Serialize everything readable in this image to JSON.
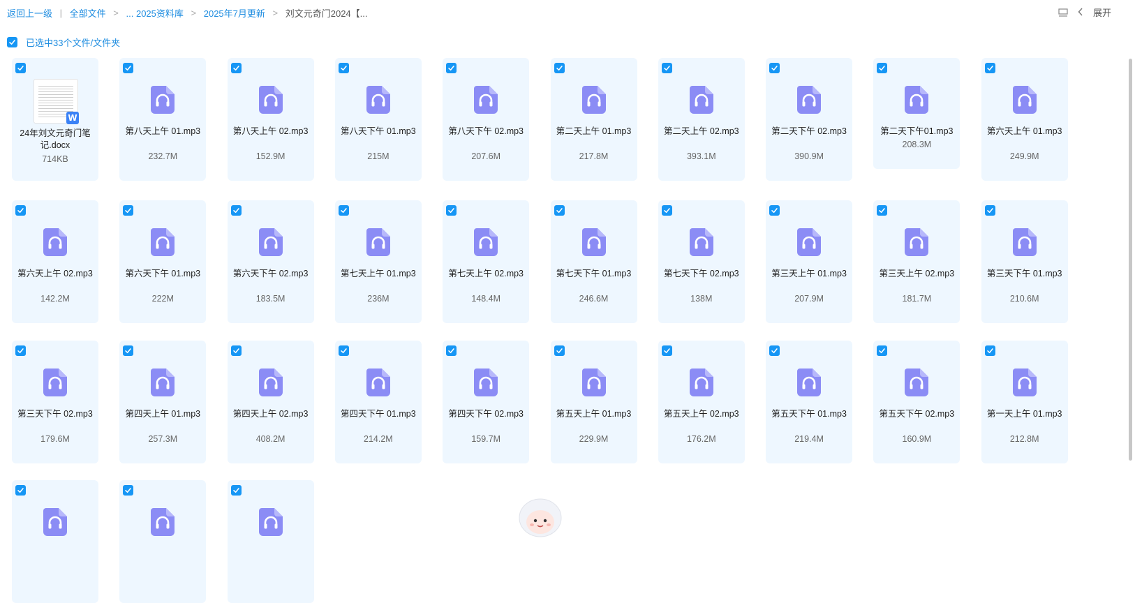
{
  "breadcrumb": {
    "back": "返回上一级",
    "all_files": "全部文件",
    "ellipsis_lib": "... 2025资料库",
    "july": "2025年7月更新",
    "current": "刘文元奇门2024【..."
  },
  "toolbar": {
    "expand_label": "展开"
  },
  "selection": {
    "label": "已选中33个文件/文件夹"
  },
  "colors": {
    "accent": "#1696f5",
    "tile_bg": "#eef7ff",
    "audio_icon": "#8b8cf5"
  },
  "files": [
    {
      "name": "24年刘文元奇门笔记.docx",
      "size": "714KB",
      "type": "doc",
      "checked": true
    },
    {
      "name": "第八天上午 01.mp3",
      "size": "232.7M",
      "type": "audio",
      "checked": true
    },
    {
      "name": "第八天上午 02.mp3",
      "size": "152.9M",
      "type": "audio",
      "checked": true
    },
    {
      "name": "第八天下午 01.mp3",
      "size": "215M",
      "type": "audio",
      "checked": true
    },
    {
      "name": "第八天下午 02.mp3",
      "size": "207.6M",
      "type": "audio",
      "checked": true
    },
    {
      "name": "第二天上午 01.mp3",
      "size": "217.8M",
      "type": "audio",
      "checked": true
    },
    {
      "name": "第二天上午 02.mp3",
      "size": "393.1M",
      "type": "audio",
      "checked": true
    },
    {
      "name": "第二天下午 02.mp3",
      "size": "390.9M",
      "type": "audio",
      "checked": true
    },
    {
      "name": "第二天下午01.mp3",
      "size": "208.3M",
      "type": "audio",
      "checked": true
    },
    {
      "name": "第六天上午 01.mp3",
      "size": "249.9M",
      "type": "audio",
      "checked": true
    },
    {
      "name": "第六天上午 02.mp3",
      "size": "142.2M",
      "type": "audio",
      "checked": true
    },
    {
      "name": "第六天下午 01.mp3",
      "size": "222M",
      "type": "audio",
      "checked": true
    },
    {
      "name": "第六天下午 02.mp3",
      "size": "183.5M",
      "type": "audio",
      "checked": true
    },
    {
      "name": "第七天上午 01.mp3",
      "size": "236M",
      "type": "audio",
      "checked": true
    },
    {
      "name": "第七天上午 02.mp3",
      "size": "148.4M",
      "type": "audio",
      "checked": true
    },
    {
      "name": "第七天下午 01.mp3",
      "size": "246.6M",
      "type": "audio",
      "checked": true
    },
    {
      "name": "第七天下午 02.mp3",
      "size": "138M",
      "type": "audio",
      "checked": true
    },
    {
      "name": "第三天上午 01.mp3",
      "size": "207.9M",
      "type": "audio",
      "checked": true
    },
    {
      "name": "第三天上午 02.mp3",
      "size": "181.7M",
      "type": "audio",
      "checked": true
    },
    {
      "name": "第三天下午 01.mp3",
      "size": "210.6M",
      "type": "audio",
      "checked": true
    },
    {
      "name": "第三天下午 02.mp3",
      "size": "179.6M",
      "type": "audio",
      "checked": true
    },
    {
      "name": "第四天上午 01.mp3",
      "size": "257.3M",
      "type": "audio",
      "checked": true
    },
    {
      "name": "第四天上午 02.mp3",
      "size": "408.2M",
      "type": "audio",
      "checked": true
    },
    {
      "name": "第四天下午 01.mp3",
      "size": "214.2M",
      "type": "audio",
      "checked": true
    },
    {
      "name": "第四天下午 02.mp3",
      "size": "159.7M",
      "type": "audio",
      "checked": true
    },
    {
      "name": "第五天上午 01.mp3",
      "size": "229.9M",
      "type": "audio",
      "checked": true
    },
    {
      "name": "第五天上午 02.mp3",
      "size": "176.2M",
      "type": "audio",
      "checked": true
    },
    {
      "name": "第五天下午 01.mp3",
      "size": "219.4M",
      "type": "audio",
      "checked": true
    },
    {
      "name": "第五天下午 02.mp3",
      "size": "160.9M",
      "type": "audio",
      "checked": true
    },
    {
      "name": "第一天上午 01.mp3",
      "size": "212.8M",
      "type": "audio",
      "checked": true
    },
    {
      "name": "",
      "size": "",
      "type": "audio",
      "checked": true
    },
    {
      "name": "",
      "size": "",
      "type": "audio",
      "checked": true
    },
    {
      "name": "",
      "size": "",
      "type": "audio",
      "checked": true
    }
  ]
}
